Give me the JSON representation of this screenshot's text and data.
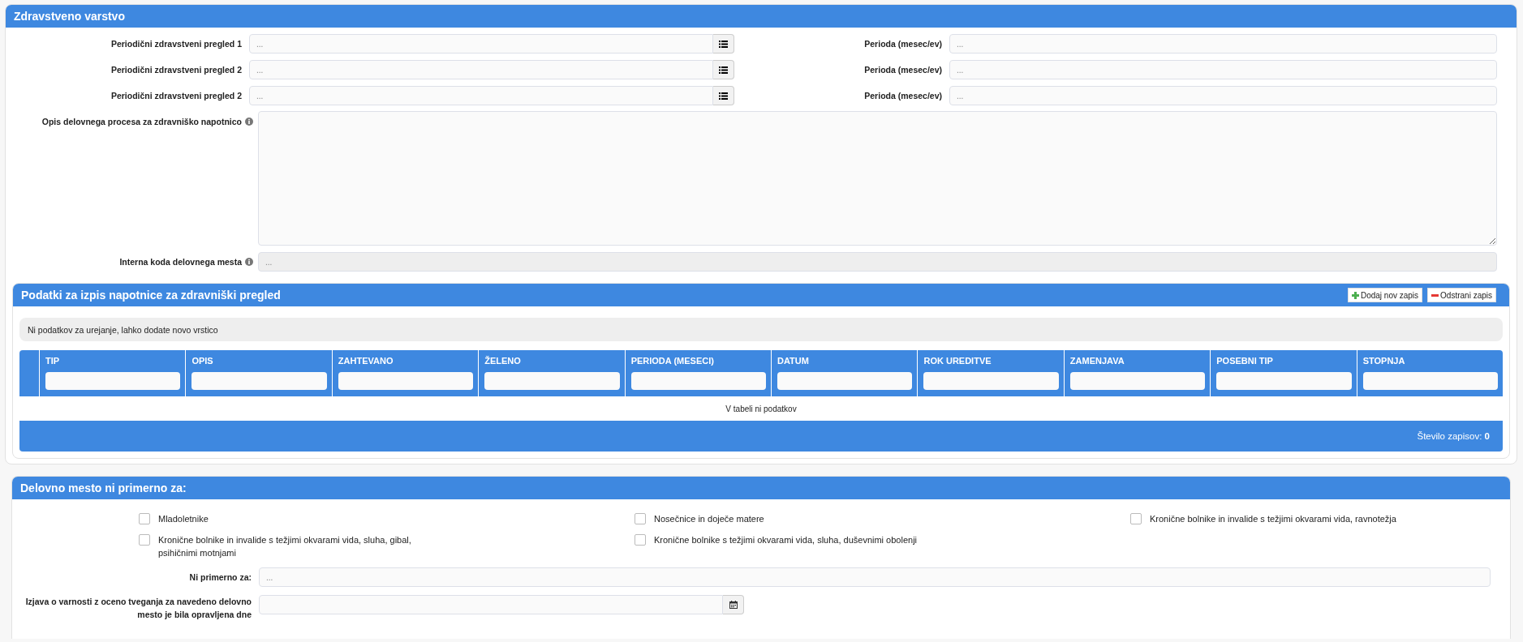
{
  "health_section": {
    "title": "Zdravstveno varstvo",
    "exam_rows": [
      {
        "exam_label": "Periodični zdravstveni pregled 1",
        "exam_placeholder": "...",
        "period_label": "Perioda (mesec/ev)",
        "period_placeholder": "..."
      },
      {
        "exam_label": "Periodični zdravstveni pregled 2",
        "exam_placeholder": "...",
        "period_label": "Perioda (mesec/ev)",
        "period_placeholder": "..."
      },
      {
        "exam_label": "Periodični zdravstveni pregled 2",
        "exam_placeholder": "...",
        "period_label": "Perioda (mesec/ev)",
        "period_placeholder": "..."
      }
    ],
    "description": {
      "label": "Opis delovnega procesa za zdravniško napotnico"
    },
    "internal_code": {
      "label": "Interna koda delovnega mesta",
      "placeholder": "...",
      "disabled": true
    }
  },
  "referral_section": {
    "title": "Podatki za izpis napotnice za zdravniški pregled",
    "buttons": [
      {
        "kind": "add",
        "label": "Dodaj nov zapis"
      },
      {
        "kind": "remove",
        "label": "Odstrani zapis"
      }
    ],
    "info": "Ni podatkov za urejanje, lahko dodate novo vrstico",
    "table": {
      "columns": [
        "TIP",
        "OPIS",
        "ZAHTEVANO",
        "ŽELENO",
        "PERIODA (MESECI)",
        "DATUM",
        "ROK UREDITVE",
        "ZAMENJAVA",
        "POSEBNI TIP",
        "STOPNJA"
      ],
      "empty_message": "V tabeli ni podatkov",
      "footer": "Število zapisov: **0**"
    }
  },
  "unsuitable_section": {
    "title": "Delovno mesto ni primerno za:",
    "options": [
      {
        "label": "Mladoletnike",
        "checked": false
      },
      {
        "label": "Nosečnice in doječe matere",
        "checked": false
      },
      {
        "label": "Kronične bolnike in invalide s težjimi okvarami vida, ravnotežja",
        "checked": false
      },
      {
        "label": "Kronične bolnike in invalide s težjimi okvarami vida, sluha, gibal, psihičnimi motnjami",
        "checked": false
      },
      {
        "label": "Kronične bolnike s težjimi okvarami vida, sluha, duševnimi obolenji",
        "checked": false
      }
    ],
    "other": {
      "label": "Ni primerno za:",
      "placeholder": "..."
    },
    "statement": {
      "label": "Izjava o varnosti z oceno tveganja za navedeno delovno mesto je bila opravljena dne"
    }
  }
}
